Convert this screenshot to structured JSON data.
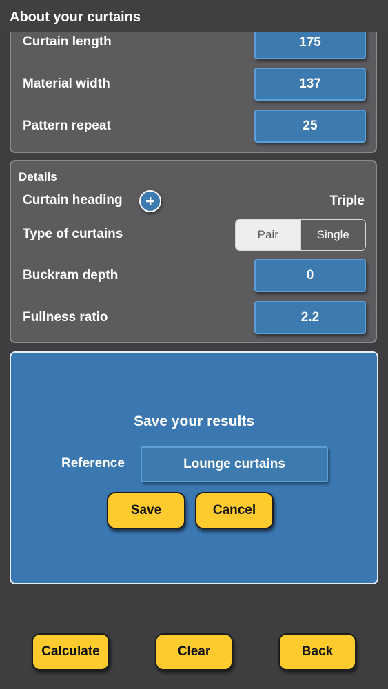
{
  "header": {
    "title": "About your curtains"
  },
  "dimensions": {
    "rows": [
      {
        "label": "Curtain length",
        "value": "175"
      },
      {
        "label": "Material width",
        "value": "137"
      },
      {
        "label": "Pattern repeat",
        "value": "25"
      }
    ]
  },
  "details": {
    "section_label": "Details",
    "curtain_heading": {
      "label": "Curtain heading",
      "value": "Triple",
      "add_icon": "plus-icon"
    },
    "type_of_curtains": {
      "label": "Type of curtains",
      "options": [
        "Pair",
        "Single"
      ],
      "selected": "Pair"
    },
    "buckram_depth": {
      "label": "Buckram depth",
      "value": "0"
    },
    "fullness_ratio": {
      "label": "Fullness ratio",
      "value": "2.2"
    }
  },
  "save_results": {
    "title": "Save your results",
    "reference_label": "Reference",
    "reference_value": "Lounge curtains",
    "save_label": "Save",
    "cancel_label": "Cancel"
  },
  "footer": {
    "calculate_label": "Calculate",
    "clear_label": "Clear",
    "back_label": "Back"
  },
  "colors": {
    "background": "#3e3e40",
    "panel": "#5c5b5e",
    "field_blue": "#3d7ab0",
    "save_panel_blue": "#3b78b2",
    "button_yellow": "#fdcb2e"
  }
}
